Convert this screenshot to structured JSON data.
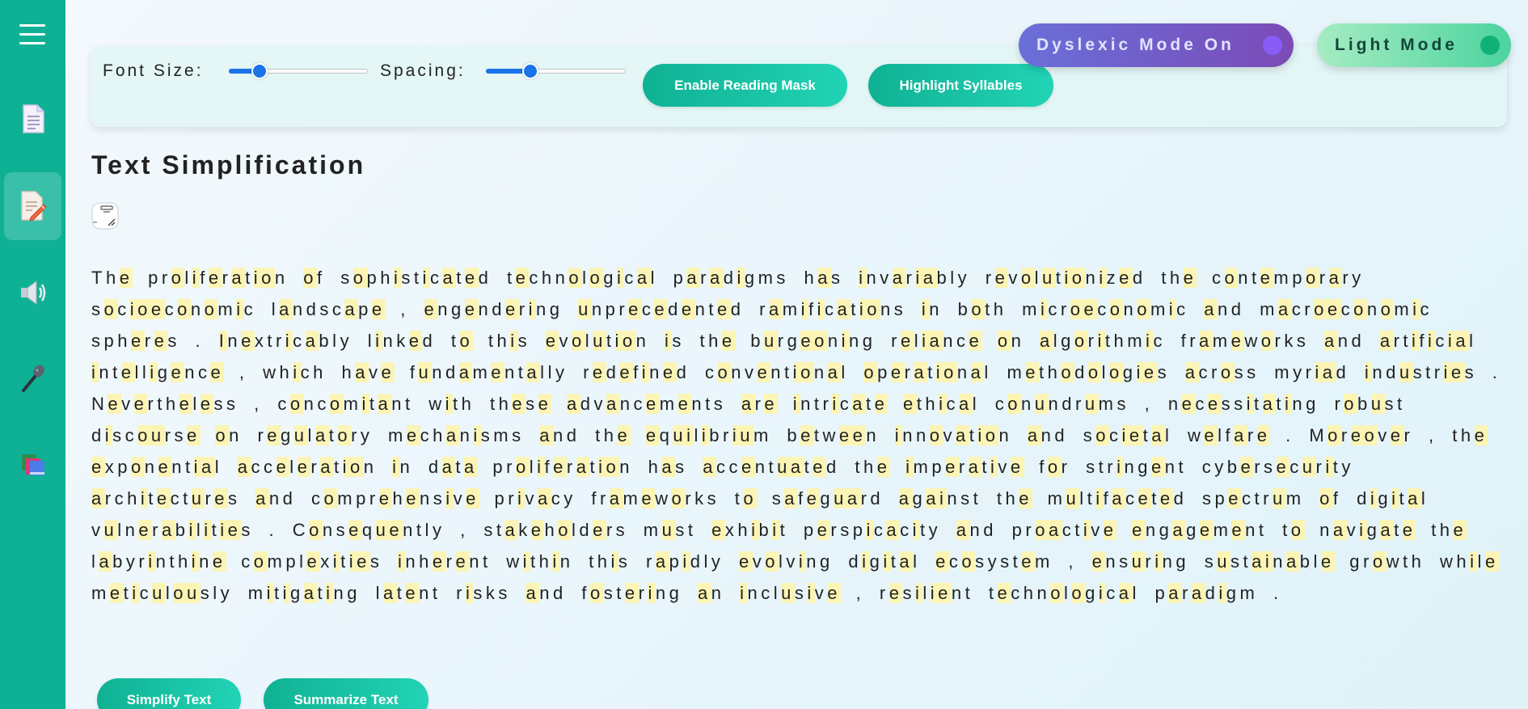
{
  "sidebar": {
    "items": [
      {
        "name": "menu",
        "icon": "hamburger-menu-icon"
      },
      {
        "name": "documents",
        "icon": "document-icon"
      },
      {
        "name": "text-simplification",
        "icon": "edit-document-icon",
        "active": true
      },
      {
        "name": "text-to-speech",
        "icon": "speaker-icon"
      },
      {
        "name": "speech-to-text",
        "icon": "microphone-icon"
      },
      {
        "name": "library",
        "icon": "books-icon"
      }
    ],
    "color": "#0fb195"
  },
  "toolbar": {
    "font_size_label": "Font Size:",
    "font_size_value": 0.22,
    "spacing_label": "Spacing:",
    "spacing_value": 0.32,
    "reading_mask_label": "Enable Reading Mask",
    "highlight_syllables_label": "Highlight Syllables"
  },
  "modes": {
    "dyslexic_label": "Dyslexic Mode On",
    "light_label": "Light Mode"
  },
  "page": {
    "title": "Text Simplification",
    "copy_icon": "copy-icon"
  },
  "text": "The proliferation of sophisticated technological paradigms has invariably revolutionized the contemporary socioeconomic landscape , engendering unprecedented ramifications in both microeconomic and macroeconomic spheres . Inextricably linked to this evolution is the burgeoning reliance on algorithmic frameworks and artificial intelligence , which have fundamentally redefined conventional operational methodologies across myriad industries . Nevertheless , concomitant with these advancements are intricate ethical conundrums , necessitating robust discourse on regulatory mechanisms and the equilibrium between innovation and societal welfare . Moreover , the exponential acceleration in data proliferation has accentuated the imperative for stringent cybersecurity architectures and comprehensive privacy frameworks to safeguard against the multifaceted spectrum of digital vulnerabilities . Consequently , stakeholders must exhibit perspicacity and proactive engagement to navigate the labyrinthine complexities inherent within this rapidly evolving digital ecosystem , ensuring sustainable growth while meticulously mitigating latent risks and fostering an inclusive , resilient technological paradigm .",
  "actions": {
    "simplify_label": "Simplify Text",
    "summarize_label": "Summarize Text"
  },
  "colors": {
    "accent": "#10b193",
    "highlight": "#fbf4b4",
    "slider": "#1a73e8",
    "dyslexic_toggle": "#6a6fd8",
    "light_toggle": "#4cd39e"
  }
}
